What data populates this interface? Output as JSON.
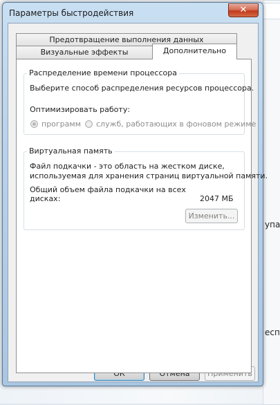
{
  "background": {
    "fragment1": "упа",
    "fragment2": "есп"
  },
  "dialog": {
    "title": "Параметры быстродействия",
    "close_label": "✕"
  },
  "tabs": [
    {
      "label": "Предотвращение выполнения данных"
    },
    {
      "label": "Визуальные эффекты"
    },
    {
      "label": "Дополнительно",
      "active": true
    }
  ],
  "cpu": {
    "title": "Распределение времени процессора",
    "description": "Выберите способ распределения ресурсов процессора.",
    "optimize_label": "Оптимизировать работу:",
    "options": [
      {
        "label": "программ",
        "selected": true
      },
      {
        "label": "служб, работающих в фоновом режиме",
        "selected": false
      }
    ]
  },
  "vm": {
    "title": "Виртуальная память",
    "desc_line1": "Файл подкачки - это область на жестком диске,",
    "desc_line2": "используемая для хранения страниц виртуальной памяти.",
    "total_line1": "Общий объем файла подкачки на всех",
    "total_line2": "дисках:",
    "total_value": "2047 МБ",
    "change_button": "Изменить..."
  },
  "buttons": {
    "ok": "ОК",
    "cancel": "Отмена",
    "apply": "Применить"
  }
}
